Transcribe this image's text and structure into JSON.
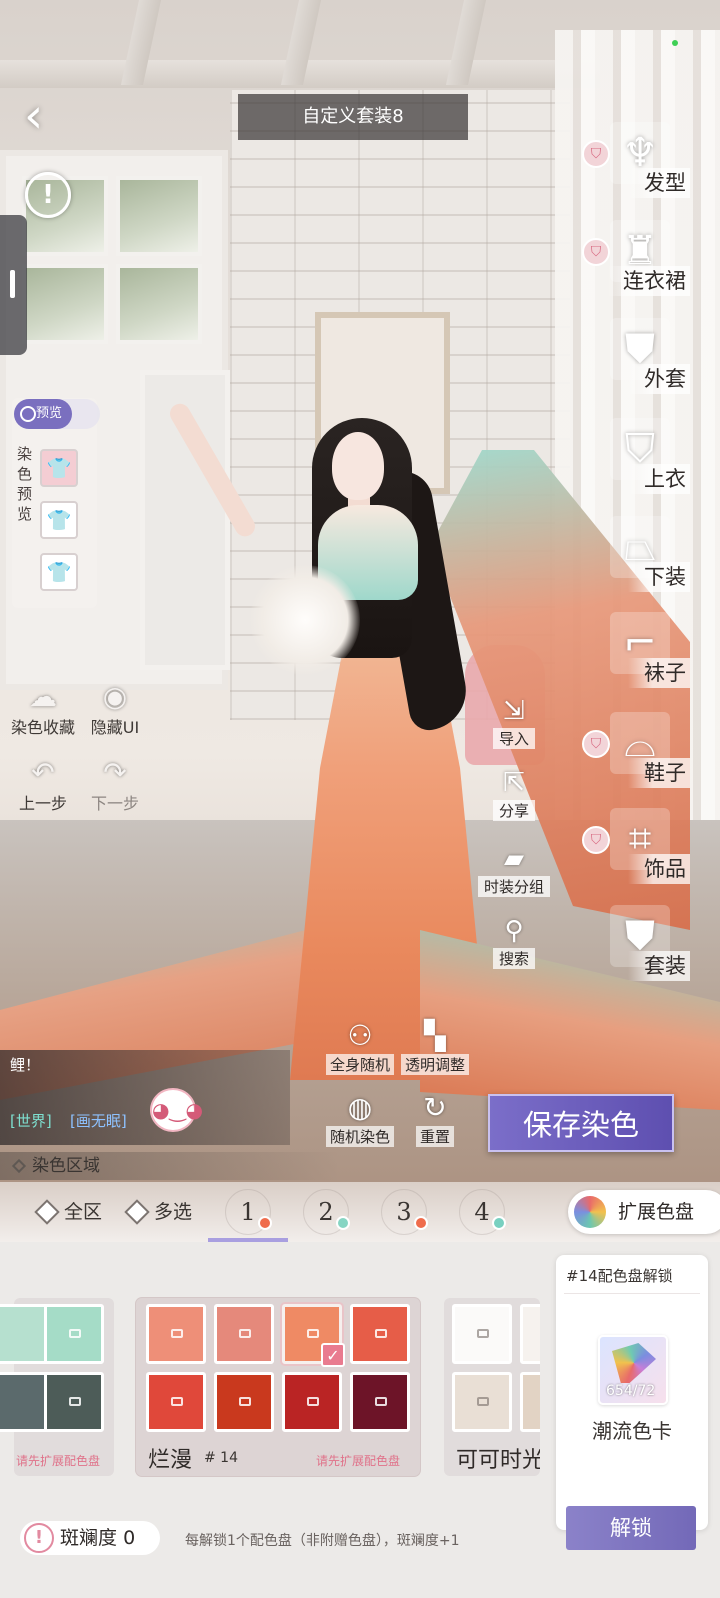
{
  "header": {
    "title": "自定义套装8"
  },
  "preview": {
    "toggle_label": "预览",
    "panel_label": "染色预览"
  },
  "left_tools": {
    "dye_favorites": "染色收藏",
    "hide_ui": "隐藏UI",
    "undo": "上一步",
    "redo": "下一步"
  },
  "categories": [
    {
      "label": "发型",
      "icon": "hair-icon",
      "badge": true
    },
    {
      "label": "连衣裙",
      "icon": "dress-icon",
      "badge": true
    },
    {
      "label": "外套",
      "icon": "coat-icon",
      "badge": false
    },
    {
      "label": "上衣",
      "icon": "top-icon",
      "badge": false
    },
    {
      "label": "下装",
      "icon": "skirt-icon",
      "badge": false
    },
    {
      "label": "袜子",
      "icon": "socks-icon",
      "badge": false
    },
    {
      "label": "鞋子",
      "icon": "shoes-icon",
      "badge": true
    },
    {
      "label": "饰品",
      "icon": "accessory-icon",
      "badge": true
    },
    {
      "label": "套装",
      "icon": "outfit-icon",
      "badge": false
    }
  ],
  "mid_tools": {
    "import": "导入",
    "share": "分享",
    "group": "时装分组",
    "search": "搜索"
  },
  "chat": {
    "message": "鲤！",
    "channel_world": "[世界]",
    "channel_name": "[画无眠]"
  },
  "center_tools": {
    "random_all": "全身随机",
    "transparency": "透明调整",
    "random_dye": "随机染色",
    "reset": "重置"
  },
  "save_button": "保存染色",
  "region_label": "染色区域",
  "tabs": {
    "all_region": "全区",
    "multi_select": "多选",
    "numbers": [
      "1",
      "2",
      "3",
      "4"
    ],
    "expand": "扩展色盘"
  },
  "palettes": {
    "left_note": "请先扩展配色盘",
    "main": {
      "name": "烂漫",
      "number": "# 14",
      "note": "请先扩展配色盘"
    },
    "right_name": "可可时光"
  },
  "unlock_card": {
    "heading": "#14配色盘解锁",
    "count": "654/72",
    "name": "潮流色卡",
    "button": "解锁"
  },
  "footer": {
    "spot_label": "斑斓度",
    "spot_value": "0",
    "note": "每解锁1个配色盘（非附赠色盘），斑斓度+1"
  },
  "colors": {
    "accent": "#6a5cb8",
    "main_row1": [
      "#ee8f78",
      "#e5897b",
      "#ef8a64",
      "#e65d48"
    ],
    "main_row2": [
      "#e0483a",
      "#c9391e",
      "#ba2424",
      "#6d1428"
    ],
    "tab_dots": [
      "#ef6c4c",
      "#86d5c3",
      "#ef6c4c",
      "#78d0c0"
    ]
  }
}
